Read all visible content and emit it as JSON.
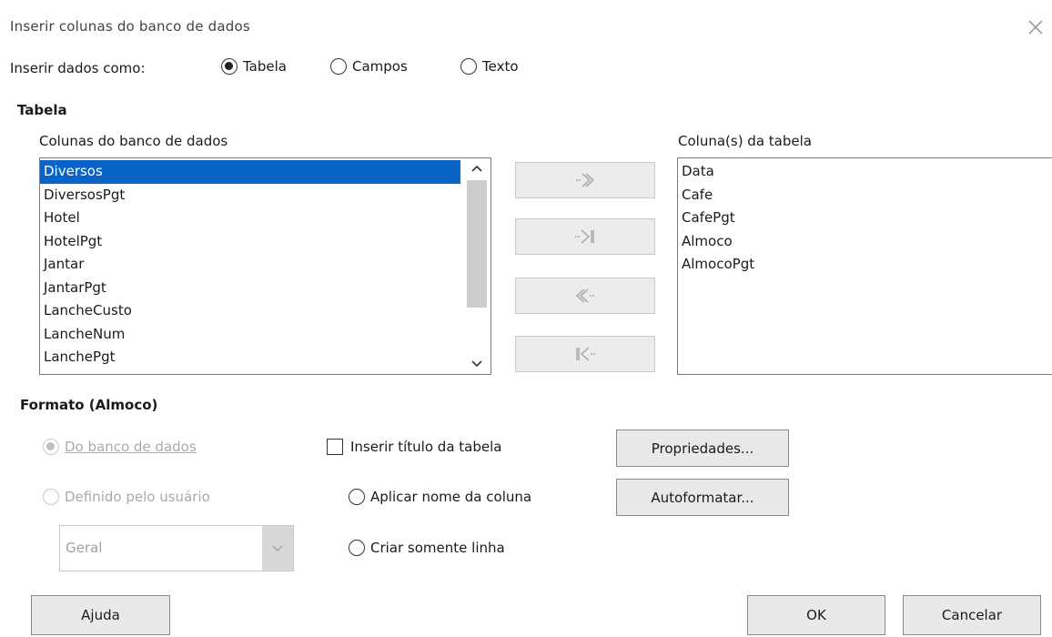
{
  "dialog": {
    "title": "Inserir colunas do banco de dados"
  },
  "insert_as": {
    "label": "Inserir dados como:",
    "options": [
      {
        "label": "Tabela",
        "selected": true
      },
      {
        "label": "Campos",
        "selected": false
      },
      {
        "label": "Texto",
        "selected": false
      }
    ]
  },
  "table_section": {
    "title": "Tabela",
    "db_columns_label": "Colunas do banco de dados",
    "db_columns": [
      "Diversos",
      "DiversosPgt",
      "Hotel",
      "HotelPgt",
      "Jantar",
      "JantarPgt",
      "LancheCusto",
      "LancheNum",
      "LanchePgt"
    ],
    "db_selected_index": 0,
    "table_columns_label": "Coluna(s) da tabela",
    "table_columns": [
      "Data",
      "Cafe",
      "CafePgt",
      "Almoco",
      "AlmocoPgt"
    ]
  },
  "format_section": {
    "title": "Formato (Almoco)",
    "from_db": {
      "label": "Do banco de dados",
      "selected": true,
      "enabled": false
    },
    "user_defined": {
      "label": "Definido pelo usuário",
      "selected": false,
      "enabled": false
    },
    "format_combo_value": "Geral",
    "insert_title": {
      "label": "Inserir título da tabela",
      "checked": false
    },
    "apply_column_name": {
      "label": "Aplicar nome da coluna",
      "selected": false
    },
    "create_row_only": {
      "label": "Criar somente linha",
      "selected": false
    },
    "properties_button": "Propriedades...",
    "autoformat_button": "Autoformatar..."
  },
  "footer": {
    "help": "Ajuda",
    "ok": "OK",
    "cancel": "Cancelar"
  },
  "colors": {
    "selection": "#0a64c8",
    "button_face": "#e9e9e9",
    "disabled_text": "#aaaaaa"
  }
}
